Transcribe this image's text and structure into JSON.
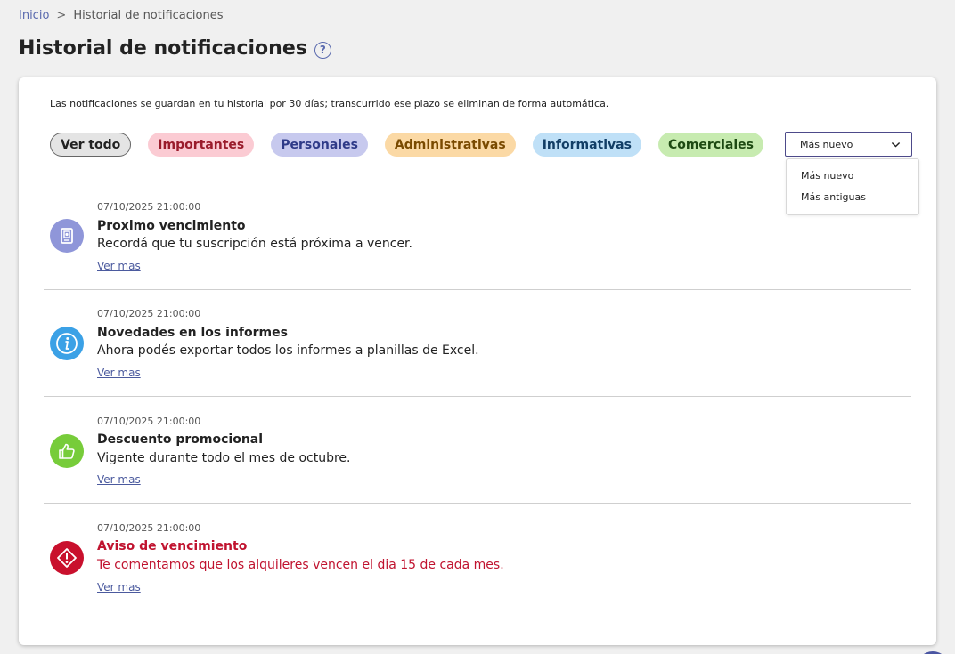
{
  "breadcrumb": {
    "home": "Inicio",
    "separator": ">",
    "current": "Historial de notificaciones"
  },
  "page": {
    "title": "Historial de notificaciones",
    "help_symbol": "?"
  },
  "info_text": "Las notificaciones se guardan en tu historial por 30 días; transcurrido ese plazo se eliminan de forma automática.",
  "filters": [
    {
      "label": "Ver todo",
      "selected": true
    },
    {
      "label": "Importantes"
    },
    {
      "label": "Personales"
    },
    {
      "label": "Administrativas"
    },
    {
      "label": "Informativas"
    },
    {
      "label": "Comerciales"
    }
  ],
  "sort": {
    "selected": "Más nuevo",
    "options": [
      "Más nuevo",
      "Más antiguas"
    ]
  },
  "notifications": [
    {
      "date": "07/10/2025 21:00:00",
      "title": "Proximo vencimiento",
      "body": "Recordá que tu suscripción está próxima a vencer.",
      "link": "Ver mas",
      "icon": "calendar-icon",
      "color": "#8f96d9"
    },
    {
      "date": "07/10/2025 21:00:00",
      "title": "Novedades en los informes",
      "body": "Ahora podés exportar todos los informes a planillas de Excel.",
      "link": "Ver mas",
      "icon": "info-icon",
      "color": "#3ba1e6"
    },
    {
      "date": "07/10/2025 21:00:00",
      "title": "Descuento promocional",
      "body": "Vigente durante todo el mes de octubre.",
      "link": "Ver mas",
      "icon": "thumbs-up-icon",
      "color": "#77cc3a"
    },
    {
      "date": "07/10/2025 21:00:00",
      "title": "Aviso de vencimiento",
      "body": "Te comentamos que los alquileres vencen el dia 15 de cada mes.",
      "link": "Ver mas",
      "icon": "warning-icon",
      "color": "#c9102d"
    }
  ]
}
